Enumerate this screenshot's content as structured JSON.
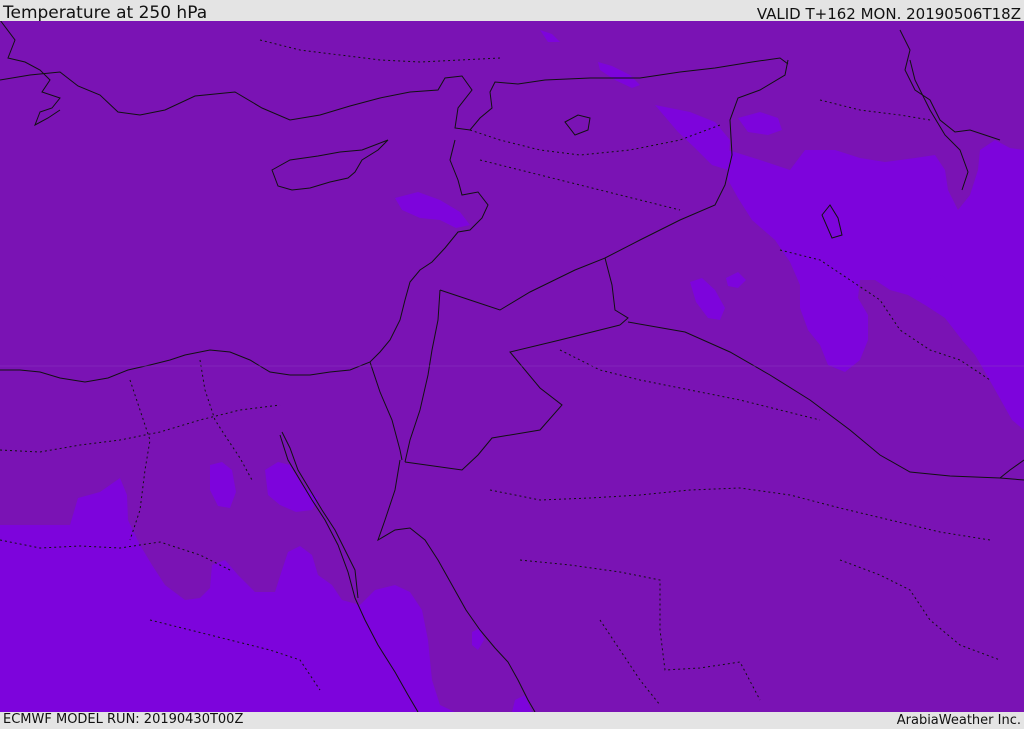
{
  "header": {
    "title": "Temperature at 250 hPa",
    "valid_time": "VALID T+162 MON. 20190506T18Z"
  },
  "footer": {
    "model_run": "ECMWF MODEL RUN: 20190430T00Z",
    "credit": "ArabiaWeather Inc."
  },
  "map": {
    "base_fill_color": "#7a13b4",
    "cold_fill_color": "#7d04dc",
    "border_color": "#111111"
  }
}
